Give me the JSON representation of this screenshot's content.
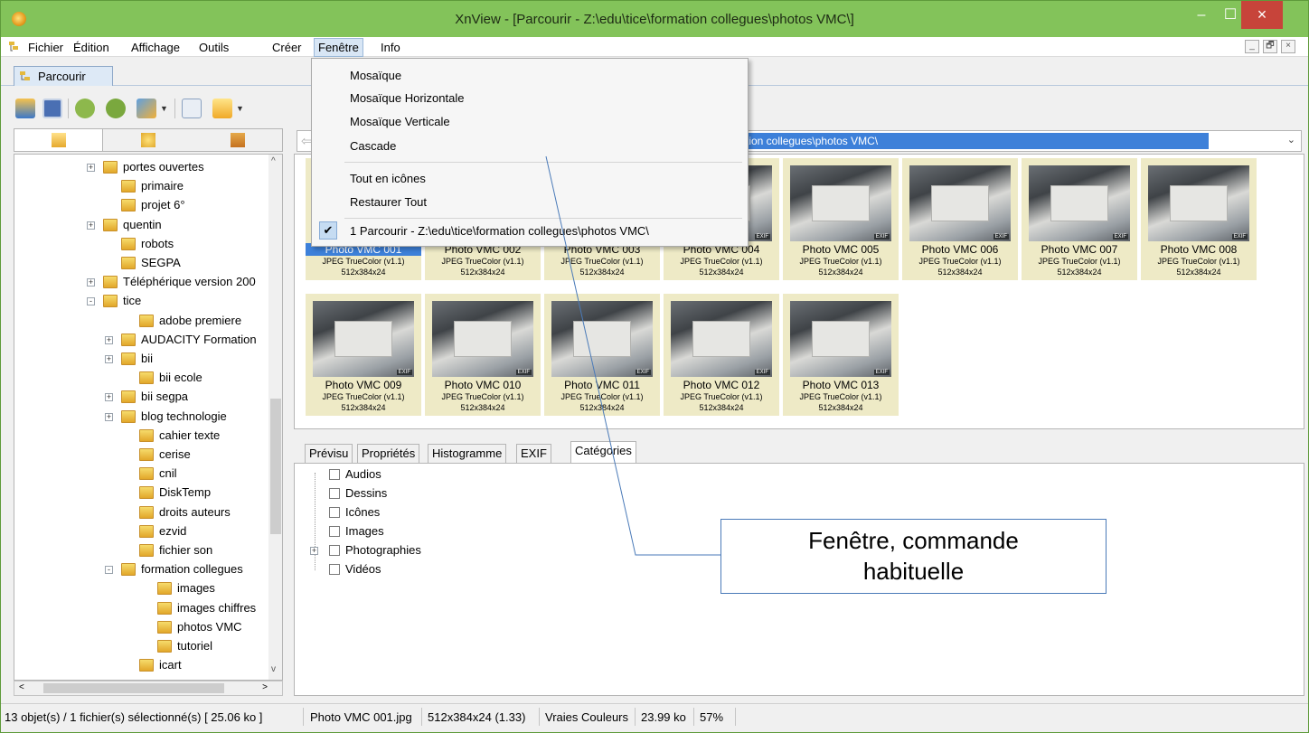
{
  "window": {
    "title": "XnView - [Parcourir - Z:\\edu\\tice\\formation collegues\\photos VMC\\]",
    "min": "–",
    "max": "☐",
    "close": "×"
  },
  "menubar": {
    "items": [
      "Fichier",
      "Édition",
      "Affichage",
      "Outils",
      "Créer",
      "Fenêtre",
      "Info"
    ],
    "mdi": [
      "_",
      "🗗",
      "×"
    ]
  },
  "tab": {
    "label": "Parcourir"
  },
  "address": {
    "value": "Z:\\edu\\tice\\formation collegues\\photos VMC\\",
    "visible": "tion collegues\\photos VMC\\"
  },
  "tree": {
    "items": [
      {
        "label": "portes ouvertes"
      },
      {
        "label": "primaire"
      },
      {
        "label": "projet 6°"
      },
      {
        "label": "quentin"
      },
      {
        "label": "robots"
      },
      {
        "label": "SEGPA"
      },
      {
        "label": "Téléphérique version 200"
      },
      {
        "label": "tice"
      },
      {
        "label": "adobe premiere"
      },
      {
        "label": "AUDACITY Formation"
      },
      {
        "label": "bii"
      },
      {
        "label": "bii ecole"
      },
      {
        "label": "bii segpa"
      },
      {
        "label": "blog technologie"
      },
      {
        "label": "cahier texte"
      },
      {
        "label": "cerise"
      },
      {
        "label": "cnil"
      },
      {
        "label": "DiskTemp"
      },
      {
        "label": "droits auteurs"
      },
      {
        "label": "ezvid"
      },
      {
        "label": "fichier son"
      },
      {
        "label": "formation collegues"
      },
      {
        "label": "images"
      },
      {
        "label": "images chiffres"
      },
      {
        "label": "photos VMC"
      },
      {
        "label": "tutoriel"
      },
      {
        "label": "icart"
      }
    ]
  },
  "thumbs": [
    {
      "name": "Photo VMC 001"
    },
    {
      "name": "Photo VMC 002"
    },
    {
      "name": "Photo VMC 003"
    },
    {
      "name": "Photo VMC 004"
    },
    {
      "name": "Photo VMC 005"
    },
    {
      "name": "Photo VMC 006"
    },
    {
      "name": "Photo VMC 007"
    },
    {
      "name": "Photo VMC 008"
    },
    {
      "name": "Photo VMC 009"
    },
    {
      "name": "Photo VMC 010"
    },
    {
      "name": "Photo VMC 011"
    },
    {
      "name": "Photo VMC 012"
    },
    {
      "name": "Photo VMC 013"
    }
  ],
  "thumb_format": "JPEG TrueColor (v1.1)",
  "thumb_dims": "512x384x24",
  "exif_badge": "EXIF",
  "bottom_tabs": [
    "Prévisu",
    "Propriétés",
    "Histogramme",
    "EXIF",
    "Catégories"
  ],
  "categories": [
    "Audios",
    "Dessins",
    "Icônes",
    "Images",
    "Photographies",
    "Vidéos"
  ],
  "status": {
    "count": "13 objet(s) / 1 fichier(s) sélectionné(s)  [ 25.06 ko ]",
    "file": "Photo VMC 001.jpg",
    "dims": "512x384x24 (1.33)",
    "colors": "Vraies Couleurs",
    "size": "23.99 ko",
    "zoom": "57%"
  },
  "dropdown": {
    "items": [
      "Mosaïque",
      "Mosaïque Horizontale",
      "Mosaïque Verticale",
      "Cascade",
      "Tout en icônes",
      "Restaurer Tout",
      "1 Parcourir - Z:\\edu\\tice\\formation collegues\\photos VMC\\"
    ],
    "check": "✔"
  },
  "callout": {
    "line1": "Fenêtre, commande",
    "line2": "habituelle"
  },
  "colors": {
    "titlebar": "#83c35a",
    "selection": "#3d80d9",
    "thumb_bg": "#eeeac6",
    "close": "#c7443a"
  }
}
